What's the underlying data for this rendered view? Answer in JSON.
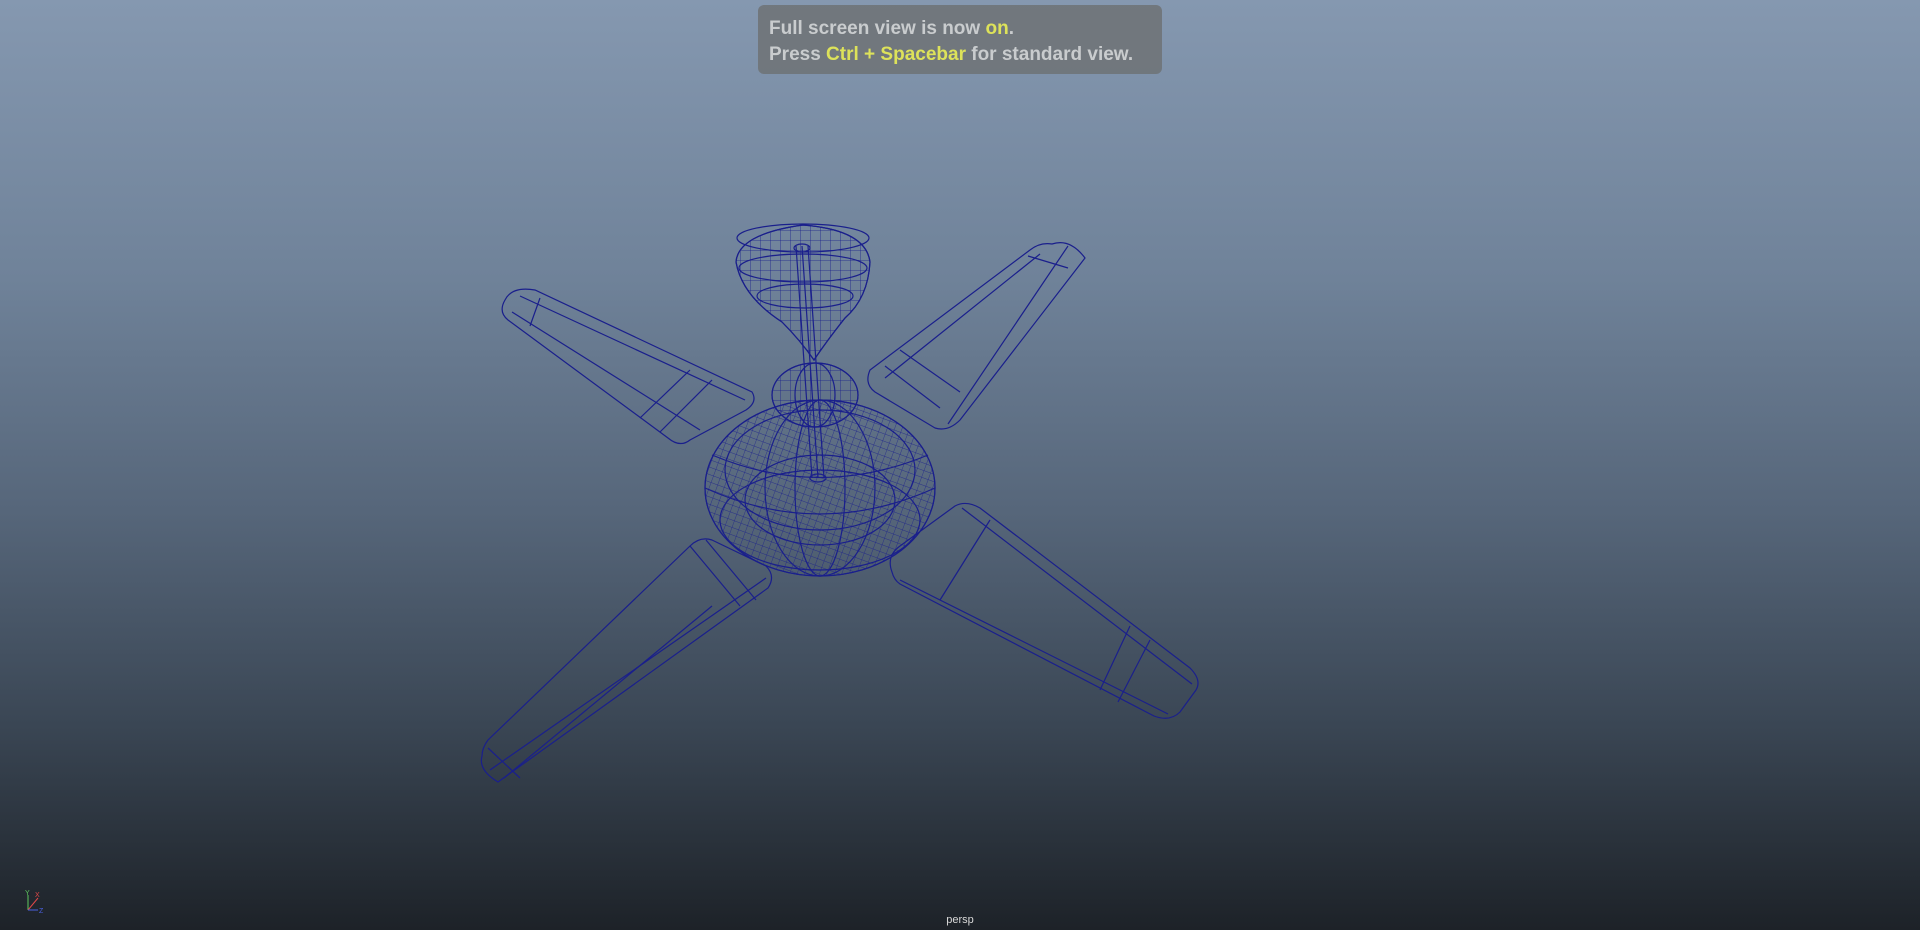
{
  "hud": {
    "line1_prefix": "Full screen view is now ",
    "line1_state": "on",
    "line1_suffix": ".",
    "line2_prefix": "Press ",
    "line2_shortcut": "Ctrl + Spacebar",
    "line2_suffix": " for standard view."
  },
  "axis": {
    "y_label": "Y",
    "x_label": "X",
    "z_label": "Z",
    "y_color": "#5ec95e",
    "x_color": "#e04848",
    "z_color": "#4a60e0"
  },
  "camera": {
    "name": "persp"
  },
  "colors": {
    "wireframe": "#1a1f8c",
    "highlight_text": "#dde25a",
    "hud_text": "#c9ccce"
  },
  "model": {
    "icon": "ceiling-fan-wireframe",
    "blade_count": 4
  }
}
